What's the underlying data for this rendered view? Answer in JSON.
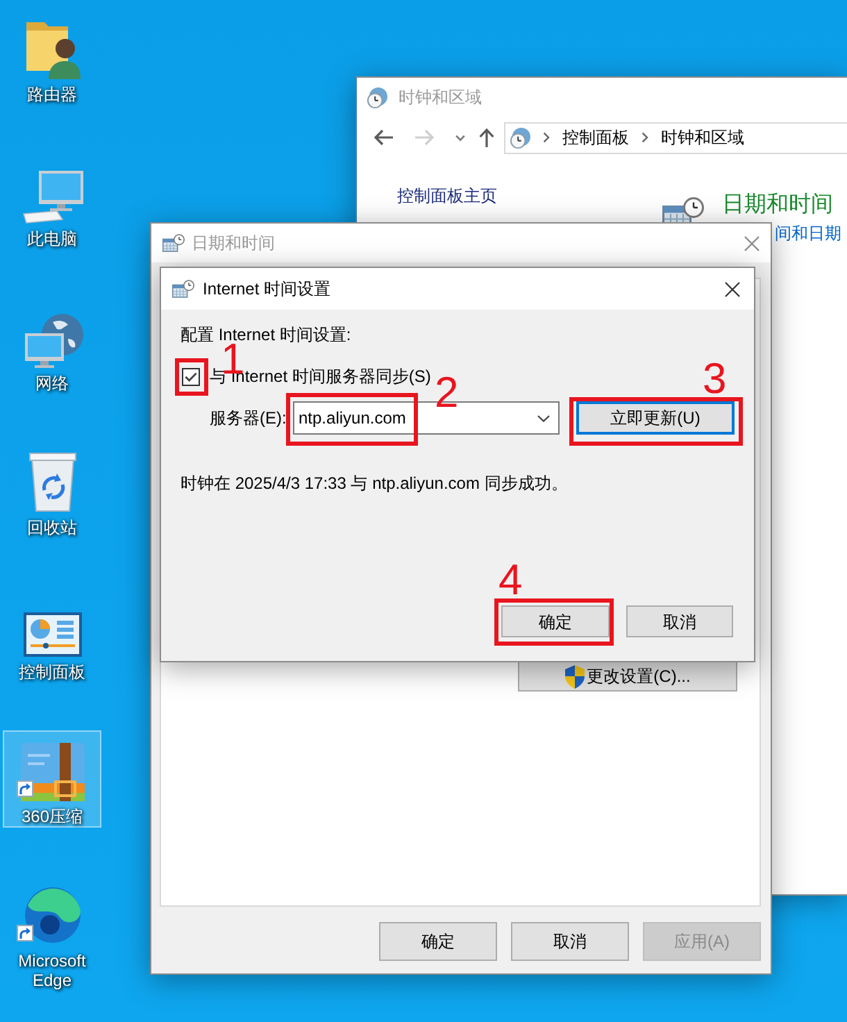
{
  "desktop": {
    "icons": [
      {
        "label": "路由器",
        "kind": "user-folder",
        "shortcut": false,
        "selected": false
      },
      {
        "label": "此电脑",
        "kind": "computer",
        "shortcut": false,
        "selected": false
      },
      {
        "label": "网络",
        "kind": "network",
        "shortcut": false,
        "selected": false
      },
      {
        "label": "回收站",
        "kind": "recycle-bin",
        "shortcut": false,
        "selected": false
      },
      {
        "label": "控制面板",
        "kind": "control-panel",
        "shortcut": false,
        "selected": false
      },
      {
        "label": "360压缩",
        "kind": "archive",
        "shortcut": true,
        "selected": true
      },
      {
        "label": "Microsoft Edge",
        "kind": "browser",
        "shortcut": true,
        "selected": false
      }
    ]
  },
  "control_panel_window": {
    "title": "时钟和区域",
    "nav_buttons": [
      {
        "kind": "back",
        "disabled": false
      },
      {
        "kind": "forward",
        "disabled": true
      },
      {
        "kind": "recent",
        "disabled": false
      },
      {
        "kind": "up",
        "disabled": false
      }
    ],
    "breadcrumb": [
      "控制面板",
      "时钟和区域"
    ],
    "sidebar_link": "控制面板主页",
    "section": {
      "title": "日期和时间",
      "links": [
        "间和日期"
      ]
    }
  },
  "date_time_window": {
    "title": "日期和时间",
    "change_settings_button": "更改设置(C)...",
    "buttons": [
      {
        "label": "确定",
        "disabled": false
      },
      {
        "label": "取消",
        "disabled": false
      },
      {
        "label": "应用(A)",
        "disabled": true
      }
    ]
  },
  "internet_time_dialog": {
    "title": "Internet 时间设置",
    "heading": "配置 Internet 时间设置:",
    "sync_checkbox": {
      "label": "与 Internet 时间服务器同步(S)",
      "checked": true,
      "callout": "1"
    },
    "server": {
      "label": "服务器(E):",
      "value": "ntp.aliyun.com",
      "callout": "2"
    },
    "update_button": {
      "label": "立即更新(U)",
      "focused": true,
      "callout": "3"
    },
    "status": "时钟在 2025/4/3 17:33 与 ntp.aliyun.com 同步成功。",
    "buttons": [
      {
        "label": "确定",
        "disabled": false,
        "callout": "4"
      },
      {
        "label": "取消",
        "disabled": false
      }
    ]
  }
}
